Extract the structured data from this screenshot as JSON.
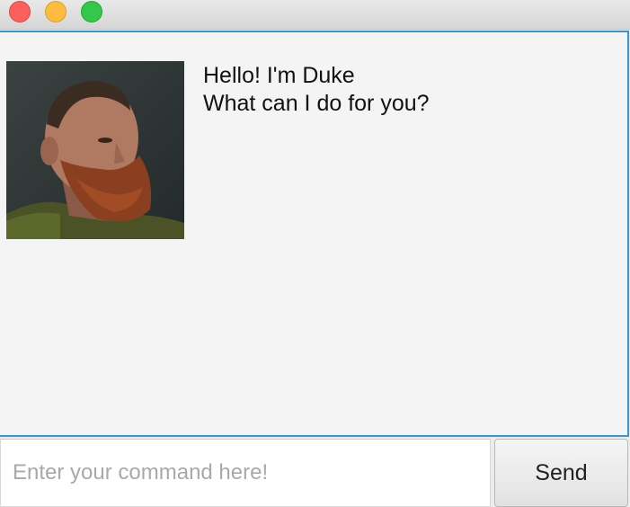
{
  "window": {
    "controls": [
      "close",
      "minimize",
      "zoom"
    ]
  },
  "chat": {
    "messages": [
      {
        "sender": "Duke",
        "avatar_icon": "bearded-man-portrait",
        "lines": [
          "Hello! I'm Duke",
          "What can I do for you?"
        ]
      }
    ]
  },
  "input": {
    "placeholder": "Enter your command here!",
    "value": ""
  },
  "send": {
    "label": "Send"
  },
  "colors": {
    "accent": "#3598d4",
    "close": "#fc605c",
    "minimize": "#fdbc40",
    "zoom": "#34c84a",
    "pane_background": "#f4f4f4"
  }
}
